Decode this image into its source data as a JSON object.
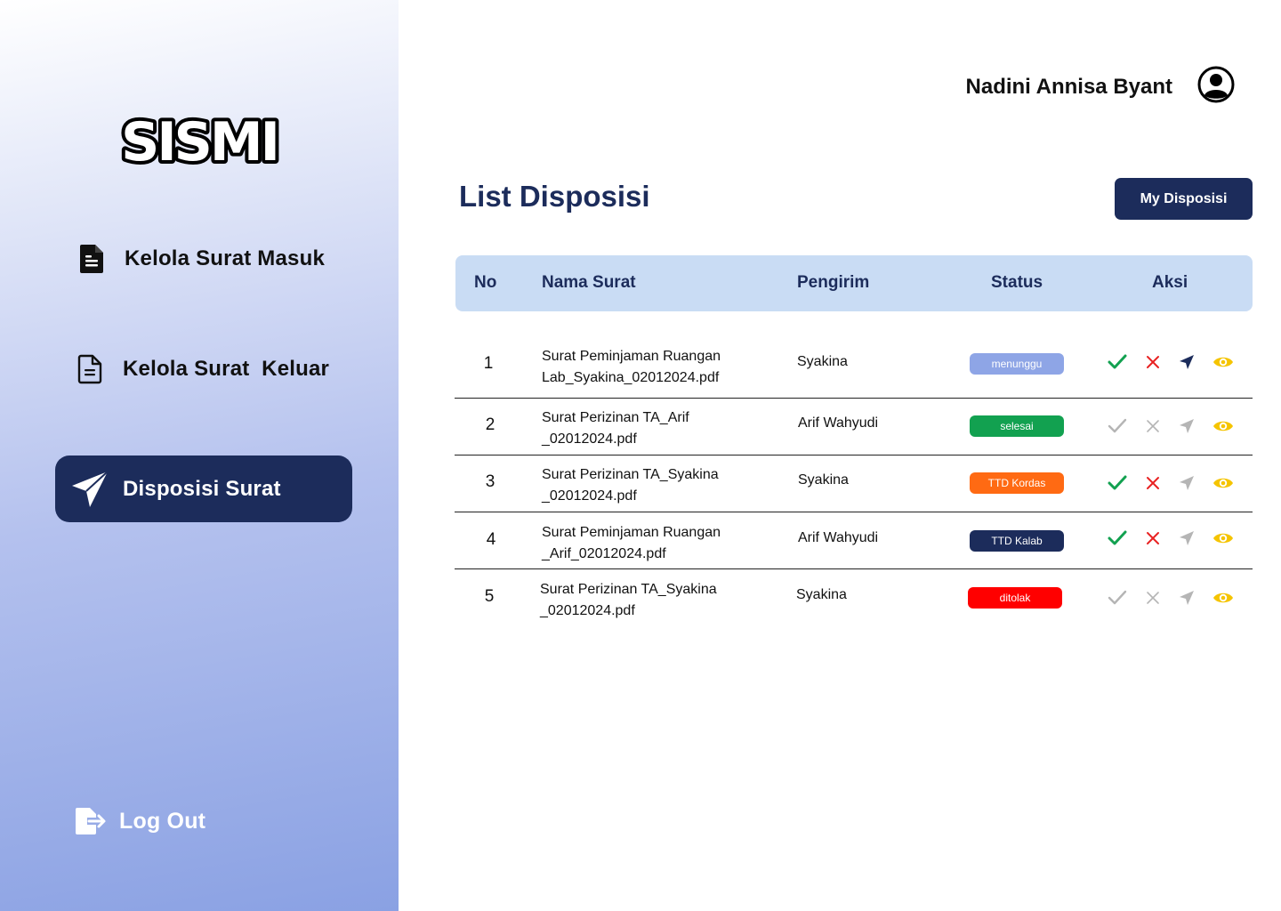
{
  "sidebar": {
    "logo_text": "SISMI",
    "items": [
      {
        "label": "Kelola Surat Masuk",
        "icon": "document-filled-icon"
      },
      {
        "label": "Kelola Surat  Keluar",
        "icon": "document-outline-icon"
      },
      {
        "label": "Disposisi Surat",
        "icon": "paper-plane-icon",
        "active": true
      }
    ],
    "logout_label": "Log Out"
  },
  "header": {
    "user_name": "Nadini Annisa Byant",
    "avatar_icon": "user-circle-icon"
  },
  "main": {
    "title": "List Disposisi",
    "my_disposisi_button": "My Disposisi",
    "columns": [
      "No",
      "Nama Surat",
      "Pengirim",
      "Status",
      "Aksi"
    ],
    "rows": [
      {
        "no": "1",
        "nama_line1": "Surat Peminjaman Ruangan",
        "nama_line2": "Lab_Syakina_02012024.pdf",
        "pengirim": "Syakina",
        "status": "menunggu",
        "actions_enabled": true
      },
      {
        "no": "2",
        "nama_line1": "Surat Perizinan TA_Arif",
        "nama_line2": "_02012024.pdf",
        "pengirim": "Arif Wahyudi",
        "status": "selesai",
        "actions_enabled": false
      },
      {
        "no": "3",
        "nama_line1": "Surat Perizinan TA_Syakina",
        "nama_line2": "_02012024.pdf",
        "pengirim": "Syakina",
        "status": "TTD Kordas",
        "actions_enabled": "partial"
      },
      {
        "no": "4",
        "nama_line1": "Surat Peminjaman Ruangan",
        "nama_line2": "_Arif_02012024.pdf",
        "pengirim": "Arif Wahyudi",
        "status": "TTD Kalab",
        "actions_enabled": "partial"
      },
      {
        "no": "5",
        "nama_line1": "Surat Perizinan TA_Syakina",
        "nama_line2": "_02012024.pdf",
        "pengirim": "Syakina",
        "status": "ditolak",
        "actions_enabled": false
      }
    ]
  },
  "colors": {
    "primary": "#1c2c5b",
    "header_bg": "#c9dcf4",
    "status_menunggu": "#8ea5e6",
    "status_selesai": "#12a150",
    "status_ttd_kordas": "#ff6a13",
    "status_ttd_kalab": "#1c2c5b",
    "status_ditolak": "#ff0000",
    "approve": "#12a150",
    "reject": "#e82323",
    "view": "#f5c400",
    "disabled": "#b5b5b5"
  }
}
